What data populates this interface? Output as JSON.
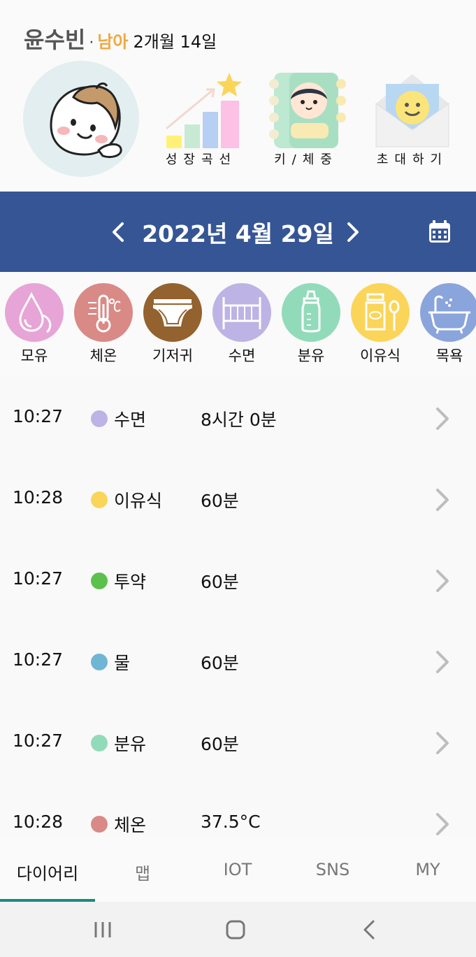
{
  "profile": {
    "name": "윤수빈",
    "separator": "·",
    "gender": "남아",
    "age": "2개월 14일"
  },
  "quick_actions": [
    {
      "label": "성장곡선",
      "icon": "growth-chart-icon"
    },
    {
      "label": "키/체중",
      "icon": "height-weight-notebook-icon"
    },
    {
      "label": "초대하기",
      "icon": "invite-envelope-icon"
    }
  ],
  "date_bar": {
    "date": "2022년 4월 29일",
    "prev_icon": "chevron-left-icon",
    "next_icon": "chevron-right-icon",
    "calendar_icon": "calendar-icon",
    "color": "#355595"
  },
  "categories": [
    {
      "label": "모유",
      "icon": "breast-milk-icon",
      "color": "#e7a4d6"
    },
    {
      "label": "체온",
      "icon": "thermometer-icon",
      "color": "#d98a86"
    },
    {
      "label": "기저귀",
      "icon": "diaper-icon",
      "color": "#93622e"
    },
    {
      "label": "수면",
      "icon": "crib-icon",
      "color": "#bdb3e4"
    },
    {
      "label": "분유",
      "icon": "baby-bottle-icon",
      "color": "#92dbba"
    },
    {
      "label": "이유식",
      "icon": "baby-food-icon",
      "color": "#fbd55a"
    },
    {
      "label": "목욕",
      "icon": "bathtub-icon",
      "color": "#8aa4dc"
    }
  ],
  "records": [
    {
      "time": "10:27",
      "type": "수면",
      "value": "8시간 0분",
      "color": "#bdb3e4"
    },
    {
      "time": "10:28",
      "type": "이유식",
      "value": "60분",
      "color": "#fbd55a"
    },
    {
      "time": "10:27",
      "type": "투약",
      "value": "60분",
      "color": "#5cc04c"
    },
    {
      "time": "10:27",
      "type": "물",
      "value": "60분",
      "color": "#6fb6d4"
    },
    {
      "time": "10:27",
      "type": "분유",
      "value": "60분",
      "color": "#92dbba"
    },
    {
      "time": "10:28",
      "type": "체온",
      "value": "37.5°C",
      "color": "#d98a86"
    }
  ],
  "tabs": [
    {
      "label": "다이어리",
      "active": true
    },
    {
      "label": "맵",
      "active": false
    },
    {
      "label": "IOT",
      "active": false
    },
    {
      "label": "SNS",
      "active": false
    },
    {
      "label": "MY",
      "active": false
    }
  ],
  "accent_color": "#1a8a80",
  "nav": {
    "recents_icon": "recents-icon",
    "home_icon": "home-icon",
    "back_icon": "back-icon"
  }
}
